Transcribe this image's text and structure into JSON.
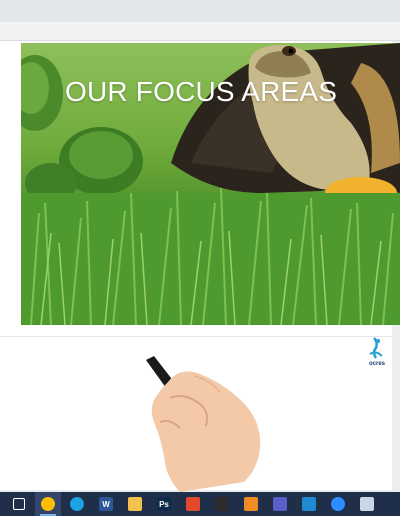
{
  "hero": {
    "title": "OUR FOCUS AREAS"
  },
  "logo": {
    "text": "ocres"
  },
  "taskbar": {
    "items": [
      {
        "icon": "task-view-icon",
        "color": "#ffffff"
      },
      {
        "icon": "chrome-icon",
        "color": "#fbbc05",
        "active": true
      },
      {
        "icon": "edge-icon",
        "color": "#1fa0e3"
      },
      {
        "icon": "word-icon",
        "color": "#2b5797",
        "label": "W"
      },
      {
        "icon": "file-explorer-icon",
        "color": "#f2c14e"
      },
      {
        "icon": "photoshop-icon",
        "color": "#0f2b4a",
        "label": "Ps"
      },
      {
        "icon": "colorful-app-icon",
        "color": "#e24a2a"
      },
      {
        "icon": "terminal-icon",
        "color": "#2d2d2d"
      },
      {
        "icon": "xampp-icon",
        "color": "#f08a24"
      },
      {
        "icon": "teams-icon",
        "color": "#5b5fc7"
      },
      {
        "icon": "vscode-icon",
        "color": "#1f8ad2"
      },
      {
        "icon": "zoom-icon",
        "color": "#2d8cff"
      },
      {
        "icon": "paint-icon",
        "color": "#c9d6e6"
      }
    ]
  }
}
